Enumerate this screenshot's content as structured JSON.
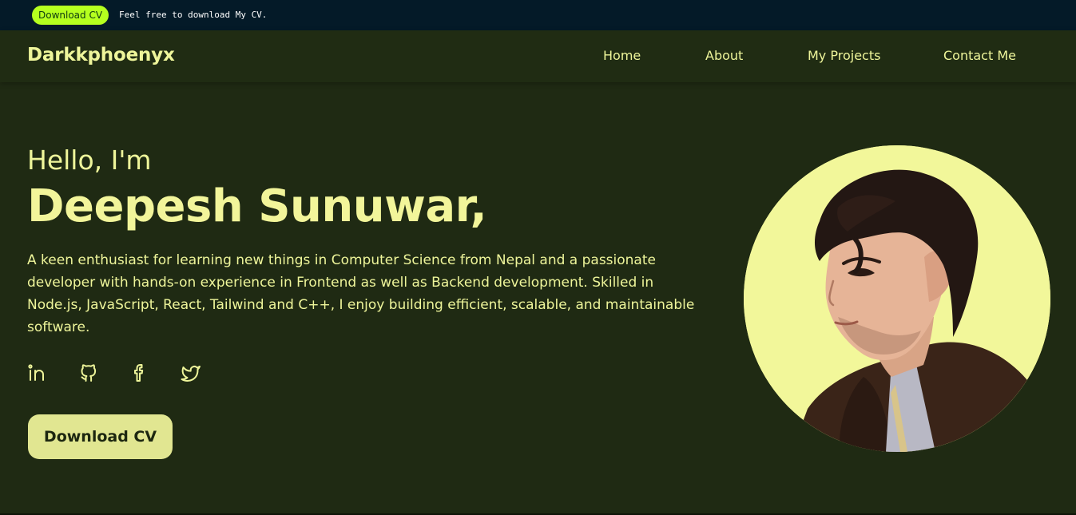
{
  "topbar": {
    "download_label": "Download CV",
    "message": "Feel free to download My CV."
  },
  "nav": {
    "brand": "Darkkphoenyx",
    "links": [
      "Home",
      "About",
      "My Projects",
      "Contact Me"
    ]
  },
  "hero": {
    "greeting": "Hello, I'm",
    "name": "Deepesh Sunuwar,",
    "bio": "A keen enthusiast for learning new things in Computer Science from Nepal and a passionate developer with hands-on experience in Frontend as well as Backend development. Skilled in Node.js, JavaScript, React, Tailwind and C++, I enjoy building efficient, scalable, and maintainable software.",
    "cta_label": "Download CV",
    "socials": [
      "linkedin-icon",
      "github-icon",
      "facebook-icon",
      "twitter-icon"
    ]
  },
  "colors": {
    "background": "#1f2a13",
    "accent": "#eef59a",
    "topbar": "#041a28",
    "topbar_button": "#b5ff1f",
    "cta_bg": "#e1e691"
  }
}
